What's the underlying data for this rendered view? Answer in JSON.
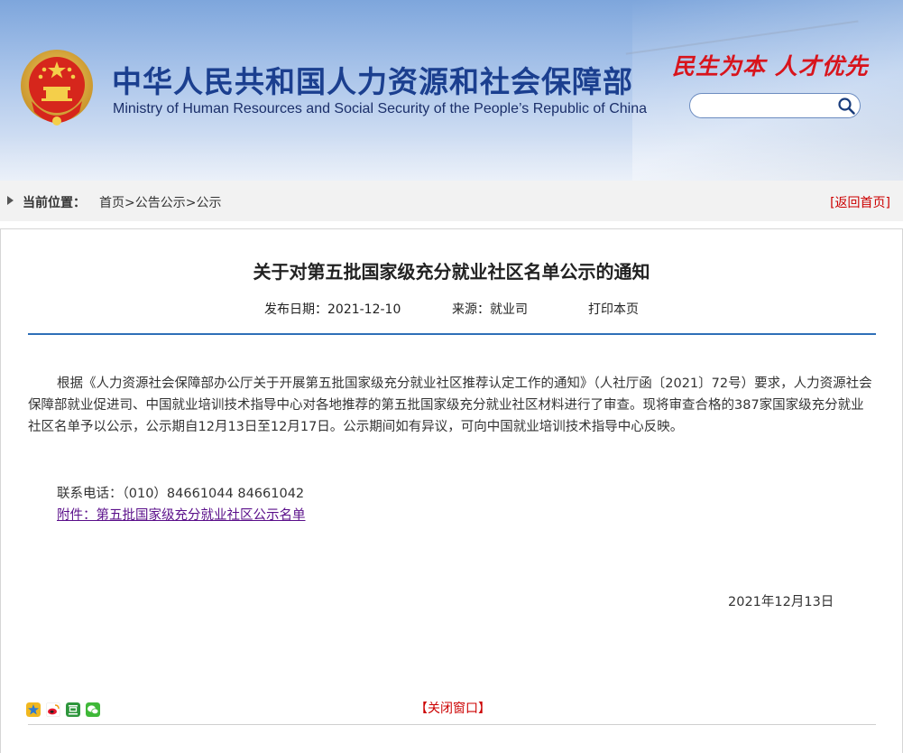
{
  "header": {
    "title_cn": "中华人民共和国人力资源和社会保障部",
    "title_en": "Ministry of Human Resources and Social Security of the People’s Republic of China",
    "slogan": "民生为本  人才优先",
    "search": {
      "placeholder": "",
      "value": ""
    }
  },
  "breadcrumb": {
    "label": "当前位置：",
    "path": [
      "首页",
      "公告公示",
      "公示"
    ],
    "separator": ">",
    "back_home": "[返回首页]"
  },
  "article": {
    "title": "关于对第五批国家级充分就业社区名单公示的通知",
    "meta": {
      "date": "发布日期：2021-12-10",
      "source": "来源：就业司",
      "print": "打印本页"
    },
    "paragraph": "根据《人力资源社会保障部办公厅关于开展第五批国家级充分就业社区推荐认定工作的通知》（人社厅函〔2021〕72号）要求，人力资源社会保障部就业促进司、中国就业培训技术指导中心对各地推荐的第五批国家级充分就业社区材料进行了审查。现将审查合格的387家国家级充分就业社区名单予以公示，公示期自12月13日至12月17日。公示期间如有异议，可向中国就业培训技术指导中心反映。",
    "contact": "联系电话：（010）84661044  84661042",
    "attachment": "附件：第五批国家级充分就业社区公示名单",
    "sign_date": "2021年12月13日"
  },
  "footer": {
    "share_icons": [
      "qzone-icon",
      "weibo-icon",
      "douban-icon",
      "wechat-icon"
    ],
    "close_window": "【关闭窗口】"
  },
  "colors": {
    "title_blue": "#1b3f8f",
    "slogan_red": "#d8141c",
    "rule_blue": "#2f6fb8",
    "link_purple": "#5a0f8a",
    "red_link": "#cc0000"
  }
}
